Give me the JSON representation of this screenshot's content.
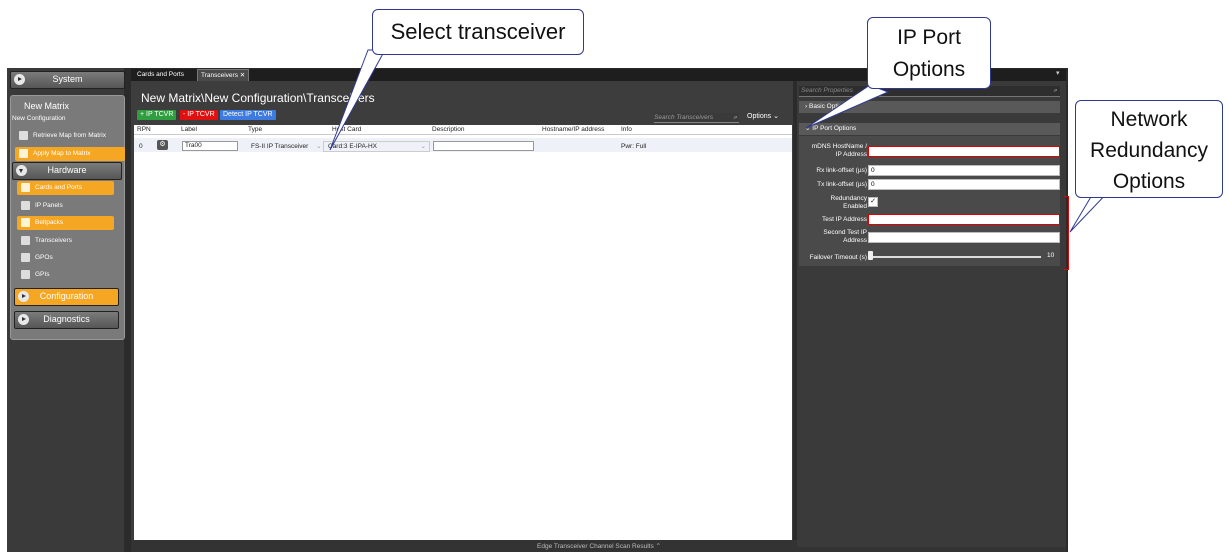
{
  "nav": {
    "system": "System",
    "matrix_title": "New Matrix",
    "matrix_subtitle": "New Configuration",
    "retrieve": "Retrieve Map from Matrix",
    "apply": "Apply Map to Matrix",
    "hardware": "Hardware",
    "items": [
      "Cards and Ports",
      "IP Panels",
      "Beltpacks",
      "Transceivers",
      "GPOs",
      "GPIs"
    ],
    "configuration": "Configuration",
    "diagnostics": "Diagnostics"
  },
  "tabs": [
    "Cards and Ports",
    "Transceivers"
  ],
  "main": {
    "path": "New Matrix\\New Configuration\\Transceivers",
    "add_btn": "+ IP TCVR",
    "remove_btn": "- IP TCVR",
    "detect_btn": "Detect IP TCVR",
    "search_placeholder": "Search Transceivers",
    "options": "Options",
    "columns": [
      "RPN",
      "Label",
      "Type",
      "Host Card",
      "Description",
      "Hostname/IP address",
      "Info"
    ],
    "row": {
      "rpn": "0",
      "label": "Tra00",
      "type": "FS-II IP Transceiver",
      "host_card": "Card:3 E-IPA-HX",
      "description": "",
      "hostname": "",
      "info": "Pwr: Full"
    },
    "bottom_bar": "Edge Transceiver Channel Scan Results"
  },
  "props": {
    "search_placeholder": "Search Properties",
    "basic": "Basic Options",
    "ip_port": "IP Port Options",
    "mdns_label": "mDNS HostName /\nIP Address",
    "mdns_value": "",
    "rx_label": "Rx link-offset (µs)",
    "rx_value": "0",
    "tx_label": "Tx link-offset (µs)",
    "tx_value": "0",
    "redundancy_label": "Redundancy\nEnabled",
    "test_ip_label": "Test IP Address",
    "test_ip_value": "",
    "second_ip_label": "Second Test IP\nAddress",
    "second_ip_value": "",
    "failover_label": "Failover Timeout (s)",
    "failover_value": "10"
  },
  "callouts": {
    "select": "Select transceiver",
    "ipport": "IP Port\nOptions",
    "network": "Network\nRedundancy\nOptions"
  },
  "colors": {
    "orange": "#f5a623",
    "green": "#2e9e3e",
    "red": "#e01010",
    "blue": "#3d7be0",
    "error": "#e00000"
  }
}
